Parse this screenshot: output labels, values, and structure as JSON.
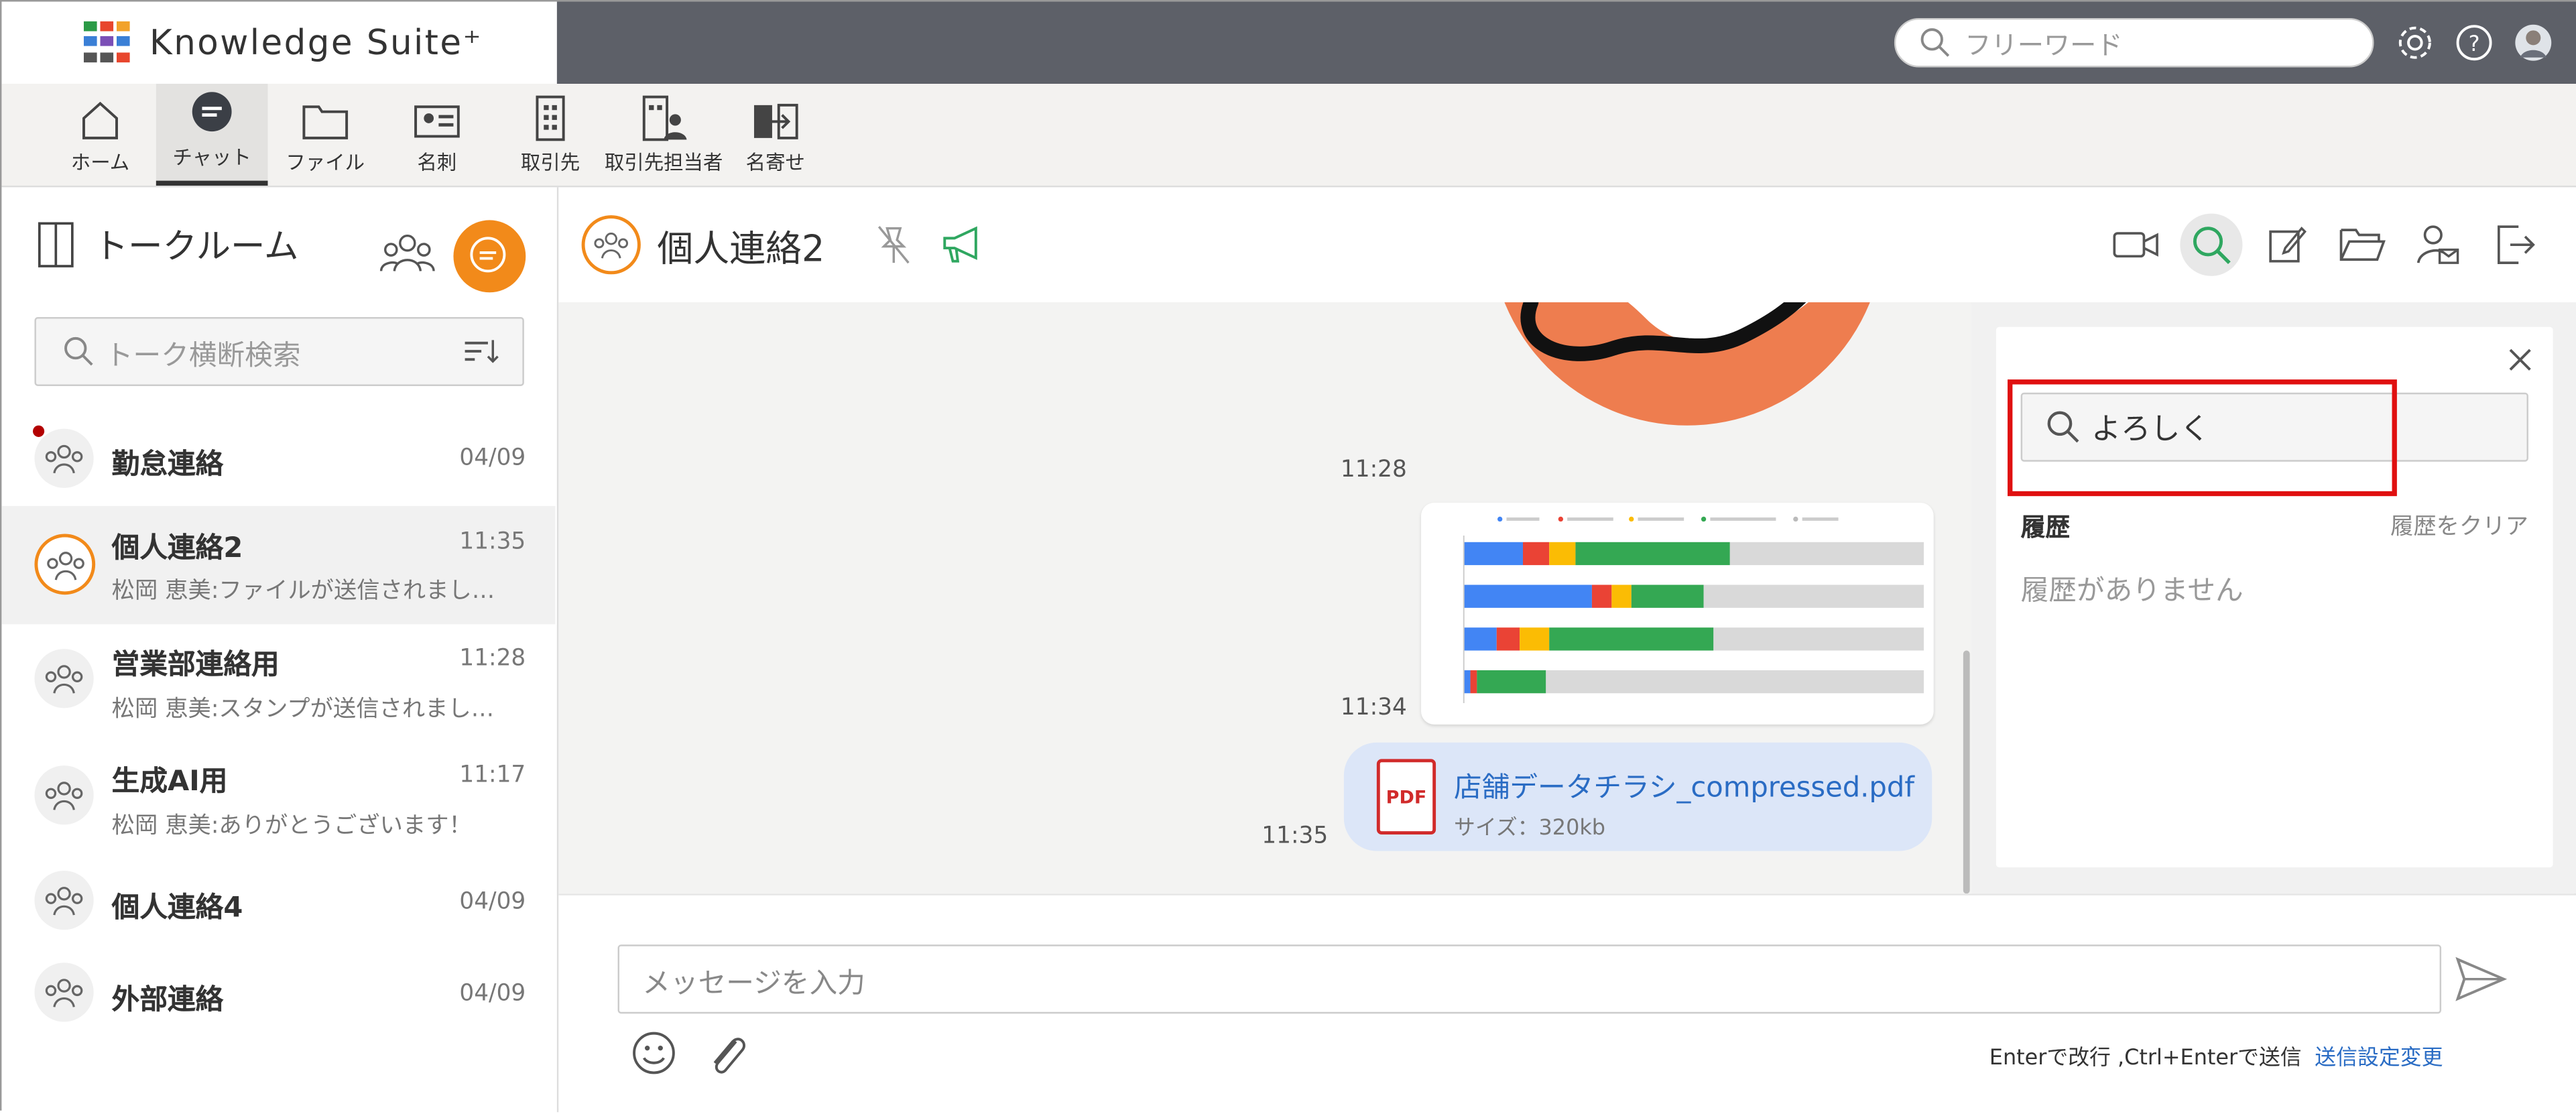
{
  "app": {
    "name": "Knowledge Suite⁺",
    "logo_colors": [
      "#2b9a46",
      "#e8462d",
      "#f2a22a",
      "#3a7fd6",
      "#7b4fb6",
      "#3a7fd6",
      "#555555",
      "#555555",
      "#e8462d"
    ]
  },
  "header": {
    "search_placeholder": "フリーワード",
    "icons": [
      "gear-icon",
      "help-icon",
      "avatar"
    ]
  },
  "nav": {
    "items": [
      {
        "label": "ホーム",
        "icon": "home-icon"
      },
      {
        "label": "チャット",
        "icon": "chat-icon",
        "active": true
      },
      {
        "label": "ファイル",
        "icon": "folder-icon"
      },
      {
        "label": "名刺",
        "icon": "card-icon"
      },
      {
        "label": "取引先",
        "icon": "building-icon"
      },
      {
        "label": "取引先担当者",
        "icon": "building-person-icon"
      },
      {
        "label": "名寄せ",
        "icon": "merge-icon"
      }
    ]
  },
  "sidebar": {
    "title": "トークルーム",
    "search_placeholder": "トーク横断検索",
    "rooms": [
      {
        "name": "勤怠連絡",
        "time": "04/09",
        "snippet": "",
        "unread": true
      },
      {
        "name": "個人連絡2",
        "time": "11:35",
        "snippet": "松岡 恵美:ファイルが送信されまし…",
        "active": true
      },
      {
        "name": "営業部連絡用",
        "time": "11:28",
        "snippet": "松岡 恵美:スタンプが送信されまし…"
      },
      {
        "name": "生成AI用",
        "time": "11:17",
        "snippet": "松岡 恵美:ありがとうございます！"
      },
      {
        "name": "個人連絡4",
        "time": "04/09",
        "snippet": ""
      },
      {
        "name": "外部連絡",
        "time": "04/09",
        "snippet": ""
      }
    ]
  },
  "chat": {
    "title": "個人連絡2",
    "messages": [
      {
        "type": "sticker",
        "time": "11:28"
      },
      {
        "type": "image",
        "time": "11:34"
      },
      {
        "type": "file",
        "time": "11:35",
        "file_name": "店舗データチラシ_compressed.pdf",
        "file_size": "サイズ：320kb",
        "file_badge": "PDF"
      }
    ]
  },
  "search_panel": {
    "query": "よろしく",
    "history_label": "履歴",
    "clear_label": "履歴をクリア",
    "empty_text": "履歴がありません"
  },
  "composer": {
    "placeholder": "メッセージを入力",
    "hint": "Enterで改行 ,Ctrl+Enterで送信",
    "settings_link": "送信設定変更"
  },
  "colors": {
    "accent_orange": "#f28a1a",
    "link_blue": "#2a6cc4",
    "highlight_red": "#e01010",
    "header_dark": "#5d6068"
  }
}
